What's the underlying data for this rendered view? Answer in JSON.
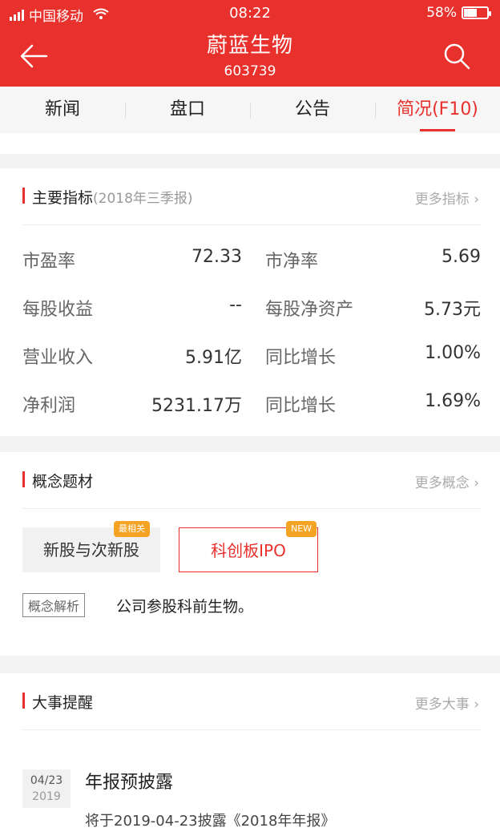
{
  "status_bar": {
    "carrier": "中国移动",
    "time": "08:22",
    "battery": "58%",
    "battery_level": 0.58
  },
  "header": {
    "title": "蔚蓝生物",
    "code": "603739",
    "back_icon": "arrow-left-icon",
    "search_icon": "search-icon"
  },
  "tabs": [
    {
      "label": "新闻"
    },
    {
      "label": "盘口"
    },
    {
      "label": "公告"
    },
    {
      "label": "简况(F10)",
      "active": true
    }
  ],
  "indicators": {
    "title": "主要指标",
    "subtitle": "(2018年三季报)",
    "more": "更多指标 ›",
    "rows": [
      {
        "label1": "市盈率",
        "value1": "72.33",
        "label2": "市净率",
        "value2": "5.69"
      },
      {
        "label1": "每股收益",
        "value1": "--",
        "label2": "每股净资产",
        "value2": "5.73元"
      },
      {
        "label1": "营业收入",
        "value1": "5.91亿",
        "label2": "同比增长",
        "value2": "1.00%"
      },
      {
        "label1": "净利润",
        "value1": "5231.17万",
        "label2": "同比增长",
        "value2": "1.69%"
      }
    ]
  },
  "concepts": {
    "title": "概念题材",
    "more": "更多概念 ›",
    "chips": [
      {
        "label": "新股与次新股",
        "badge": "最相关"
      },
      {
        "label": "科创板IPO",
        "badge": "NEW"
      }
    ],
    "analysis_label": "概念解析",
    "analysis_text": "公司参股科前生物。"
  },
  "events": {
    "title": "大事提醒",
    "more": "更多大事 ›",
    "items": [
      {
        "date": "04/23",
        "year": "2019",
        "title": "年报预披露",
        "desc": "将于2019-04-23披露《2018年年报》"
      }
    ]
  },
  "colors": {
    "accent": "#e8302c",
    "badge": "#f4a324"
  }
}
